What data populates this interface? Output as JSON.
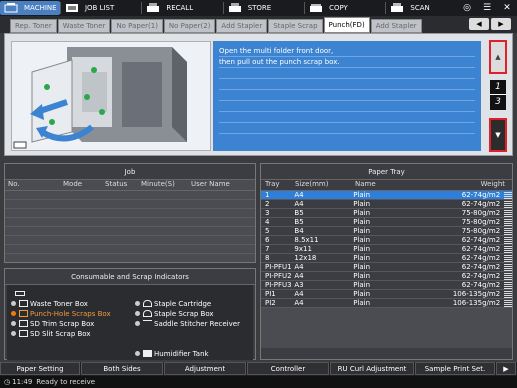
{
  "topbar": {
    "tabs": [
      {
        "label": "MACHINE",
        "icon": "machine-icon",
        "active": true
      },
      {
        "label": "JOB LIST",
        "icon": "job-list-icon"
      },
      {
        "label": "RECALL",
        "icon": "recall-icon"
      },
      {
        "label": "STORE",
        "icon": "store-icon"
      },
      {
        "label": "COPY",
        "icon": "copy-icon"
      },
      {
        "label": "SCAN",
        "icon": "scan-icon"
      }
    ]
  },
  "warning_tabs": [
    "Rep. Toner",
    "Waste Toner",
    "No Paper(1)",
    "No Paper(2)",
    "Add Stapler",
    "Staple Scrap",
    "Punch(FD)",
    "Add Stapler"
  ],
  "active_warning": "Punch(FD)",
  "guidance": {
    "message_line1": "Open the multi folder front door,",
    "message_line2": "then pull out the punch scrap box.",
    "page_current": "1",
    "page_total": "3"
  },
  "job": {
    "title": "Job",
    "columns": [
      "No.",
      "Mode",
      "Status",
      "Minute(S)",
      "User Name"
    ]
  },
  "consumables": {
    "title": "Consumable and Scrap Indicators",
    "left": [
      {
        "label": "Waste Toner Box",
        "warn": false
      },
      {
        "label": "Punch-Hole Scraps Box",
        "warn": true
      },
      {
        "label": "SD Trim Scrap Box",
        "warn": false
      },
      {
        "label": "SD Slit Scrap Box",
        "warn": false
      }
    ],
    "right": [
      {
        "label": "Staple Cartridge"
      },
      {
        "label": "Staple Scrap Box"
      },
      {
        "label": "Saddle Stitcher Receiver"
      },
      {
        "label": "Humidifier Tank"
      }
    ]
  },
  "tray": {
    "title": "Paper Tray",
    "columns": [
      "Tray",
      "Size(mm)",
      "Name",
      "Weight"
    ],
    "rows": [
      [
        "1",
        "A4",
        "Plain",
        "62-74g/m2"
      ],
      [
        "2",
        "A4",
        "Plain",
        "62-74g/m2"
      ],
      [
        "3",
        "B5",
        "Plain",
        "75-80g/m2"
      ],
      [
        "4",
        "B5",
        "Plain",
        "75-80g/m2"
      ],
      [
        "5",
        "B4",
        "Plain",
        "75-80g/m2"
      ],
      [
        "6",
        "8.5x11",
        "Plain",
        "62-74g/m2"
      ],
      [
        "7",
        "9x11",
        "Plain",
        "62-74g/m2"
      ],
      [
        "8",
        "12x18",
        "Plain",
        "62-74g/m2"
      ],
      [
        "PI-PFU1",
        "A4",
        "Plain",
        "62-74g/m2"
      ],
      [
        "PI-PFU2",
        "A4",
        "Plain",
        "62-74g/m2"
      ],
      [
        "PI-PFU3",
        "A3",
        "Plain",
        "62-74g/m2"
      ],
      [
        "PI1",
        "A4",
        "Plain",
        "106-135g/m2"
      ],
      [
        "PI2",
        "A4",
        "Plain",
        "106-135g/m2"
      ]
    ],
    "selected_index": 0
  },
  "bottom": {
    "buttons": [
      "Paper Setting",
      "Both Sides",
      "Adjustment",
      "Controller",
      "RU Curl Adjustment",
      "Sample Print Set."
    ]
  },
  "status": {
    "time": "11:49",
    "text": "Ready to receive"
  }
}
